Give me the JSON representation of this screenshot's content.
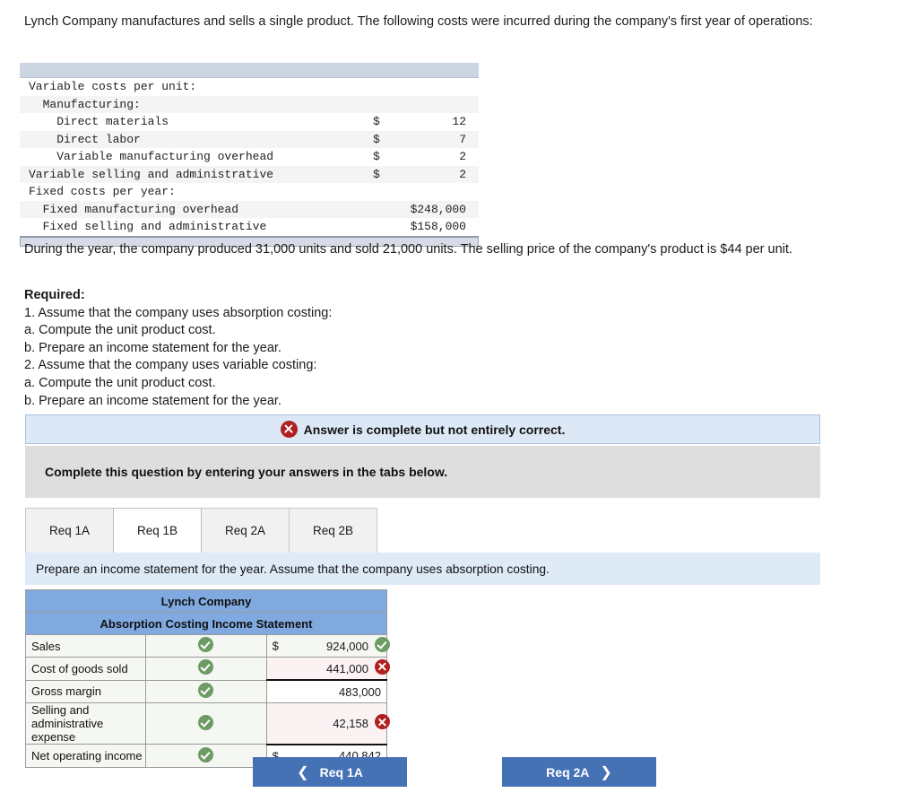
{
  "problem": {
    "intro": "Lynch Company manufactures and sells a single product. The following costs were incurred during the company's first year of operations:",
    "mid_paragraph": "During the year, the company produced 31,000 units and sold 21,000 units. The selling price of the company's product is $44 per unit.",
    "required_heading": "Required:",
    "required_items": [
      "1. Assume that the company uses absorption costing:",
      "a. Compute the unit product cost.",
      "b. Prepare an income statement for the year.",
      "2. Assume that the company uses variable costing:",
      "a. Compute the unit product cost.",
      "b. Prepare an income statement for the year."
    ]
  },
  "cost_table": {
    "rows": [
      {
        "label": "Variable costs per unit:",
        "currency": "",
        "value": "",
        "shaded": false
      },
      {
        "label": "  Manufacturing:",
        "currency": "",
        "value": "",
        "shaded": true
      },
      {
        "label": "    Direct materials",
        "currency": "$",
        "value": "12",
        "shaded": false
      },
      {
        "label": "    Direct labor",
        "currency": "$",
        "value": "7",
        "shaded": true
      },
      {
        "label": "    Variable manufacturing overhead",
        "currency": "$",
        "value": "2",
        "shaded": false
      },
      {
        "label": "Variable selling and administrative",
        "currency": "$",
        "value": "2",
        "shaded": true
      },
      {
        "label": "Fixed costs per year:",
        "currency": "",
        "value": "",
        "shaded": false
      },
      {
        "label": "  Fixed manufacturing overhead",
        "currency": "",
        "value": "$248,000",
        "shaded": true
      },
      {
        "label": "  Fixed selling and administrative",
        "currency": "",
        "value": "$158,000",
        "shaded": false
      }
    ]
  },
  "status_banner": {
    "icon": "error-x-icon",
    "text": "Answer is complete but not entirely correct."
  },
  "instruction_bar": {
    "text": "Complete this question by entering your answers in the tabs below."
  },
  "tabs": [
    {
      "label": "Req 1A",
      "active": false
    },
    {
      "label": "Req 1B",
      "active": true
    },
    {
      "label": "Req 2A",
      "active": false
    },
    {
      "label": "Req 2B",
      "active": false
    }
  ],
  "tab_instruction": {
    "text": "Prepare an income statement for the year. Assume that the company uses absorption costing."
  },
  "statement": {
    "title": "Lynch Company",
    "subtitle": "Absorption Costing Income Statement",
    "rows": [
      {
        "label": "Sales",
        "label_mark": "check-icon",
        "currency": "$",
        "amount": "924,000",
        "amount_mark": "check-icon",
        "style": "normal"
      },
      {
        "label": "Cost of goods sold",
        "label_mark": "check-icon",
        "currency": "",
        "amount": "441,000",
        "amount_mark": "error-x-icon",
        "style": "wrong"
      },
      {
        "label": "Gross margin",
        "label_mark": "check-icon",
        "currency": "",
        "amount": "483,000",
        "amount_mark": "",
        "style": "subtotal"
      },
      {
        "label": "Selling and administrative expense",
        "label_mark": "check-icon",
        "currency": "",
        "amount": "42,158",
        "amount_mark": "error-x-icon",
        "style": "wrong"
      },
      {
        "label": "Net operating income",
        "label_mark": "check-icon",
        "currency": "$",
        "amount": "440,842",
        "amount_mark": "",
        "style": "total"
      }
    ]
  },
  "nav": {
    "prev_label": "Req 1A",
    "next_label": "Req 2A",
    "prev_icon": "chevron-left-icon",
    "next_icon": "chevron-right-icon"
  },
  "colors": {
    "header_blue": "#80a9e0",
    "banner_blue": "#dce8f6",
    "instruction_gray": "#dedede",
    "tabinfo_blue": "#dfeaf7",
    "button_blue": "#4472b5",
    "check_green": "#6d9b64",
    "error_red": "#b02020"
  }
}
